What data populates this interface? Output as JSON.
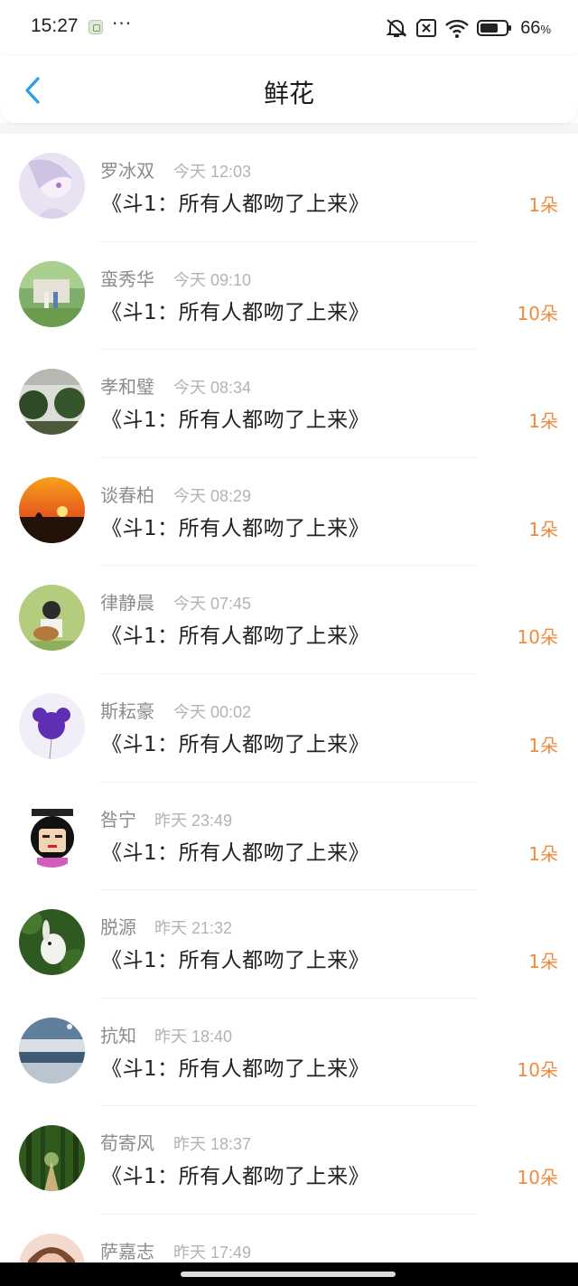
{
  "status_bar": {
    "time": "15:27",
    "more": "···",
    "battery": "66",
    "battery_unit": "%"
  },
  "header": {
    "title": "鲜花",
    "back_icon": "chevron-left-icon"
  },
  "colors": {
    "accent_blue": "#2f9ee9",
    "count_orange": "#f08a3c"
  },
  "items": [
    {
      "name": "罗冰双",
      "time": "今天 12:03",
      "book": "《斗1：所有人都吻了上来》",
      "count": "1朵"
    },
    {
      "name": "蛮秀华",
      "time": "今天 09:10",
      "book": "《斗1：所有人都吻了上来》",
      "count": "10朵"
    },
    {
      "name": "孝和璧",
      "time": "今天 08:34",
      "book": "《斗1：所有人都吻了上来》",
      "count": "1朵"
    },
    {
      "name": "谈春柏",
      "time": "今天 08:29",
      "book": "《斗1：所有人都吻了上来》",
      "count": "1朵"
    },
    {
      "name": "律静晨",
      "time": "今天 07:45",
      "book": "《斗1：所有人都吻了上来》",
      "count": "10朵"
    },
    {
      "name": "斯耘豪",
      "time": "今天 00:02",
      "book": "《斗1：所有人都吻了上来》",
      "count": "1朵"
    },
    {
      "name": "咎宁",
      "time": "昨天 23:49",
      "book": "《斗1：所有人都吻了上来》",
      "count": "1朵"
    },
    {
      "name": "脱源",
      "time": "昨天 21:32",
      "book": "《斗1：所有人都吻了上来》",
      "count": "1朵"
    },
    {
      "name": "抗知",
      "time": "昨天 18:40",
      "book": "《斗1：所有人都吻了上来》",
      "count": "10朵"
    },
    {
      "name": "荀寄风",
      "time": "昨天 18:37",
      "book": "《斗1：所有人都吻了上来》",
      "count": "10朵"
    },
    {
      "name": "萨嘉志",
      "time": "昨天 17:49",
      "book": "",
      "count": ""
    }
  ]
}
